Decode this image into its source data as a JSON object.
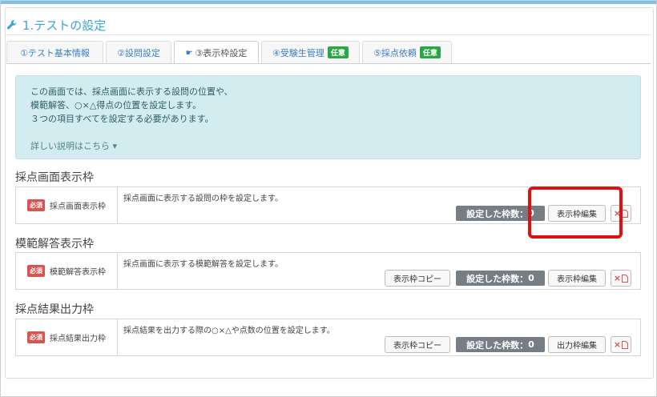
{
  "title": "1.テストの設定",
  "tabs": [
    {
      "label": "①テスト基本情報",
      "badge": ""
    },
    {
      "label": "②設問設定",
      "badge": ""
    },
    {
      "label": "③表示枠設定",
      "badge": ""
    },
    {
      "label": "④受験生管理",
      "badge": "任意"
    },
    {
      "label": "⑤採点依頼",
      "badge": "任意"
    }
  ],
  "info": {
    "lines": [
      "この画面では、採点画面に表示する設問の位置や、",
      "模範解答、○×△得点の位置を設定します。",
      "３つの項目すべてを設定する必要があります。"
    ],
    "more": "詳しい説明はこちら ▾"
  },
  "sections": [
    {
      "heading": "採点画面表示枠",
      "required": "必須",
      "label": "採点画面表示枠",
      "description": "採点画面に表示する設問の枠を設定します。",
      "count_label": "設定した枠数：",
      "count_value": "0",
      "edit_label": "表示枠編集"
    },
    {
      "heading": "模範解答表示枠",
      "required": "必須",
      "label": "模範解答表示枠",
      "description": "採点画面に表示する模範解答を設定します。",
      "copy_label": "表示枠コピー",
      "count_label": "設定した枠数：",
      "count_value": "0",
      "edit_label": "表示枠編集"
    },
    {
      "heading": "採点結果出力枠",
      "required": "必須",
      "label": "採点結果出力枠",
      "description": "採点結果を出力する際の○×△や点数の位置を設定します。",
      "copy_label": "表示枠コピー",
      "count_label": "設定した枠数：",
      "count_value": "0",
      "edit_label": "出力枠編集"
    }
  ],
  "colors": {
    "accent": "#3aa3d8",
    "highlight": "#e01010",
    "required": "#d9534f",
    "optional_badge": "#29a745"
  }
}
